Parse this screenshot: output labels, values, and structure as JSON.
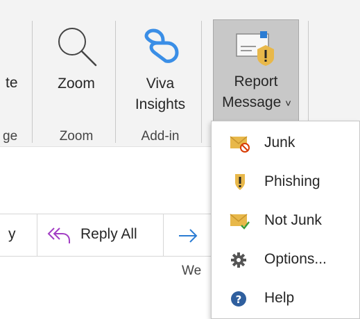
{
  "ribbon": {
    "partial_button_label": "te",
    "partial_group_label": "ge",
    "zoom": {
      "button_label": "Zoom",
      "group_label": "Zoom"
    },
    "viva": {
      "line1": "Viva",
      "line2": "Insights",
      "group_label": "Add-in"
    },
    "report": {
      "line1": "Report",
      "line2": "Message",
      "chevron": "˅"
    }
  },
  "reply_bar": {
    "partial_label": "y",
    "reply_all_label": "Reply All"
  },
  "date_partial": "We",
  "menu": {
    "items": [
      {
        "label": "Junk",
        "icon": "junk-envelope-icon"
      },
      {
        "label": "Phishing",
        "icon": "shield-alert-icon"
      },
      {
        "label": "Not Junk",
        "icon": "not-junk-envelope-icon"
      },
      {
        "label": "Options...",
        "icon": "gear-icon"
      },
      {
        "label": "Help",
        "icon": "help-icon"
      }
    ]
  },
  "colors": {
    "ribbon_bg": "#f3f3f3",
    "pressed_button": "#c8c8c8",
    "viva_accent": "#3a8ee6",
    "reply_all_accent": "#a23ec4",
    "forward_accent": "#2b7cd3",
    "envelope": "#e8b84a",
    "alert_red": "#d83b01",
    "help_blue": "#2f5f9e"
  }
}
